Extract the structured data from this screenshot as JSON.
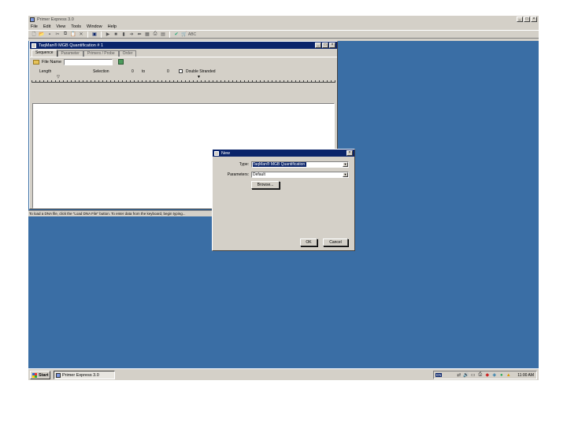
{
  "app": {
    "title": "Primer Express 3.0",
    "menu": [
      "File",
      "Edit",
      "View",
      "Tools",
      "Window",
      "Help"
    ],
    "toolbar_icons": [
      "new-icon",
      "open-icon",
      "save-icon",
      "cut-icon",
      "copy-icon",
      "paste-icon",
      "delete-icon",
      "blue-window-icon",
      "play-icon",
      "stop-icon",
      "pause-icon",
      "forward-icon",
      "back-icon",
      "grid-icon",
      "print-icon",
      "preview-icon",
      "checkmark-icon",
      "cart-icon",
      "abc-icon"
    ]
  },
  "child": {
    "title": "TaqMan® MGB Quantification # 1",
    "tabs": [
      "Sequence",
      "Parameter",
      "Primers / Probe",
      "Order"
    ],
    "file_label": "File Name",
    "file_value": "",
    "length_label": "Length",
    "selection_label": "Selection",
    "sel_from": "0",
    "to_label": "to",
    "sel_to": "0",
    "double_stranded_label": "Double Stranded"
  },
  "status": {
    "text": "To load a DNA file, click the \"Load DNA File\" button. To enter data from the keyboard, begin typing..."
  },
  "dialog": {
    "title": "New",
    "type_label": "Type:",
    "type_value": "TaqMan® MGB Quantification",
    "params_label": "Parameters:",
    "params_value": "Default",
    "browse_label": "Browse...",
    "ok_label": "OK",
    "cancel_label": "Cancel"
  },
  "taskbar": {
    "start_label": "Start",
    "task_label": "Primer Express 3.0",
    "lang": "EN",
    "tray_icons": [
      "network-icon",
      "speaker-icon",
      "monitor-icon",
      "printer-icon",
      "antivirus-icon",
      "shield-icon",
      "security-icon",
      "update-icon"
    ],
    "clock": "11:00 AM"
  },
  "colors": {
    "desktop": "#3a6ea5",
    "titlebar_active": "#0a246a",
    "face": "#d4d0c8"
  }
}
